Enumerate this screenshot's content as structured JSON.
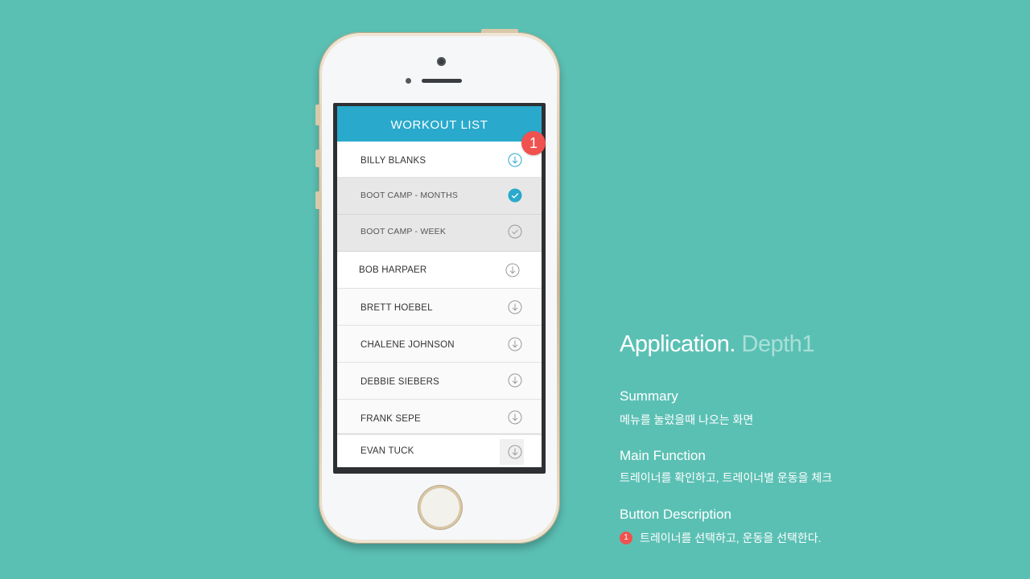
{
  "app": {
    "header_title": "WORKOUT LIST",
    "badge_number": "1",
    "rows": [
      {
        "label": "BILLY BLANKS",
        "type": "trainer",
        "icon": "arrow-down-circle-icon",
        "active": true
      },
      {
        "label": "BOOT CAMP - MONTHS",
        "type": "workout",
        "icon": "check-filled-icon",
        "checked": true
      },
      {
        "label": "BOOT CAMP - WEEK",
        "type": "workout",
        "icon": "check-outline-icon",
        "checked": false
      },
      {
        "label": "BOB HARPAER",
        "type": "trainer",
        "icon": "arrow-down-circle-icon"
      },
      {
        "label": "BRETT HOEBEL",
        "type": "trainer",
        "icon": "arrow-down-circle-icon"
      },
      {
        "label": "CHALENE JOHNSON",
        "type": "trainer",
        "icon": "arrow-down-circle-icon"
      },
      {
        "label": "DEBBIE SIEBERS",
        "type": "trainer",
        "icon": "arrow-down-circle-icon"
      },
      {
        "label": "FRANK SEPE",
        "type": "trainer",
        "icon": "arrow-down-circle-icon"
      },
      {
        "label": "EVAN TUCK",
        "type": "trainer",
        "icon": "arrow-down-circle-icon"
      }
    ]
  },
  "description": {
    "title_main": "Application.",
    "title_sub": "Depth1",
    "summary_heading": "Summary",
    "summary_text": "메뉴를 눌렀을때 나오는 화면",
    "main_function_heading": "Main Function",
    "main_function_text": "트레이너를 확인하고, 트레이너별 운동을 체크",
    "button_description_heading": "Button Description",
    "button_badge": "1",
    "button_description_text": "트레이너를 선택하고, 운동을 선택한다."
  },
  "colors": {
    "background": "#5bc0b4",
    "header": "#29a9cc",
    "badge": "#f0524f",
    "title_sub": "#a8e0d8"
  }
}
